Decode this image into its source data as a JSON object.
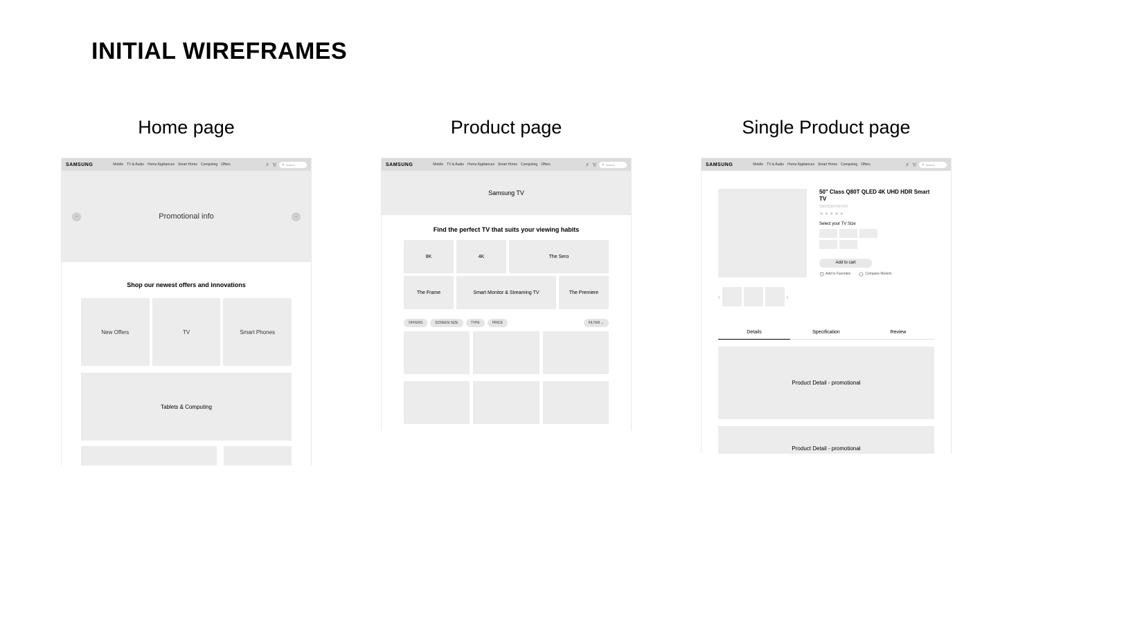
{
  "page_title": "INITIAL WIREFRAMES",
  "columns": {
    "home": "Home page",
    "product": "Product page",
    "single": "Single Product page"
  },
  "header": {
    "logo": "SAMSUNG",
    "nav": [
      "Mobile",
      "TV & Audio",
      "Home Appliances",
      "Smart Home",
      "Computing",
      "Offers"
    ],
    "search_placeholder": "Search"
  },
  "home": {
    "hero": "Promotional info",
    "shop_title": "Shop our newest offers and innovations",
    "cards": [
      "New Offers",
      "TV",
      "Smart Phones"
    ],
    "wide_card": "Tablets & Computing"
  },
  "product": {
    "banner": "Samsung TV",
    "tagline": "Find the perfect TV that suits your viewing habits",
    "row1": {
      "a": "8K",
      "b": "4K",
      "c": "The Sero"
    },
    "row2": {
      "a": "The Frame",
      "b": "Smart Monitor & Streaming TV",
      "c": "The Premiere"
    },
    "filters": [
      "OFFERS",
      "SCREEN SIZE",
      "TYPE",
      "PRICE"
    ],
    "filter_button": "FILTER  ⌄"
  },
  "single": {
    "title": "50\" Class Q80T QLED 4K UHD HDR Smart TV",
    "sku": "QN50Q80TAFXZA",
    "size_label": "Select your TV Size",
    "add_to_cart": "Add to cart",
    "fav": "Add to Favorites",
    "compare": "Compare Models",
    "tabs": [
      "Details",
      "Specification",
      "Review"
    ],
    "promo1": "Product Detail - promotional",
    "promo2": "Product Detail - promotional"
  }
}
